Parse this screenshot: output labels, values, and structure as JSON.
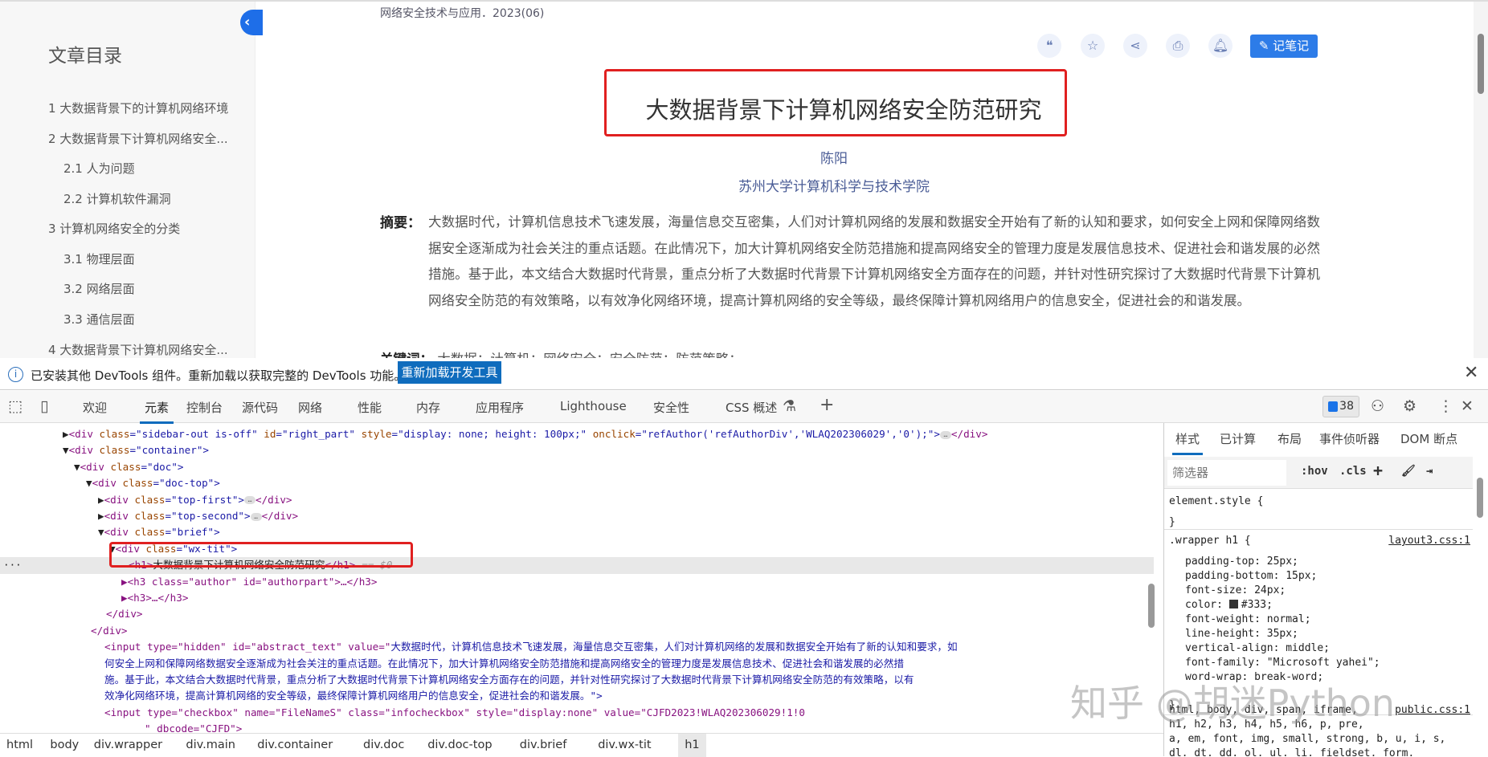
{
  "toc": {
    "title": "文章目录",
    "items": [
      {
        "label": "1 大数据背景下的计算机网络环境",
        "sub": false
      },
      {
        "label": "2 大数据背景下计算机网络安全...",
        "sub": false
      },
      {
        "label": "2.1 人为问题",
        "sub": true
      },
      {
        "label": "2.2 计算机软件漏洞",
        "sub": true
      },
      {
        "label": "3 计算机网络安全的分类",
        "sub": false
      },
      {
        "label": "3.1 物理层面",
        "sub": true
      },
      {
        "label": "3.2 网络层面",
        "sub": true
      },
      {
        "label": "3.3 通信层面",
        "sub": true
      },
      {
        "label": "4 大数据背景下计算机网络安全...",
        "sub": false
      }
    ]
  },
  "article": {
    "journal": "网络安全技术与应用．2023(06)",
    "toolbar": {
      "quote_icon": "quote-icon",
      "fav_icon": "star-icon",
      "share_icon": "share-icon",
      "print_icon": "printer-icon",
      "alert_icon": "bell-icon",
      "note_label": "记笔记"
    },
    "title": "大数据背景下计算机网络安全防范研究",
    "author": "陈阳",
    "affiliation": "苏州大学计算机科学与技术学院",
    "abstract_label": "摘要：",
    "abstract": "大数据时代，计算机信息技术飞速发展，海量信息交互密集，人们对计算机网络的发展和数据安全开始有了新的认知和要求，如何安全上网和保障网络数据安全逐渐成为社会关注的重点话题。在此情况下，加大计算机网络安全防范措施和提高网络安全的管理力度是发展信息技术、促进社会和谐发展的必然措施。基于此，本文结合大数据时代背景，重点分析了大数据时代背景下计算机网络安全方面存在的问题，并针对性研究探讨了大数据时代背景下计算机网络安全防范的有效策略，以有效净化网络环境，提高计算机网络的安全等级，最终保障计算机网络用户的信息安全，促进社会的和谐发展。",
    "keywords_label": "关键词：",
    "keywords": "大数据；计算机；网络安全；安全防范；防范策略；"
  },
  "devtools": {
    "info_message": "已安装其他 DevTools 组件。重新加载以获取完整的 DevTools 功能。",
    "reload_button": "重新加载开发工具",
    "tabs": [
      "欢迎",
      "元素",
      "控制台",
      "源代码",
      "网络",
      "性能",
      "内存",
      "应用程序",
      "Lighthouse",
      "安全性",
      "CSS 概述"
    ],
    "active_tab": "元素",
    "issues_count": "38",
    "dom_lines": [
      [
        "▶",
        "<div ",
        "class",
        "=\"sidebar-out is-off\" ",
        "id",
        "=\"right_part\" ",
        "style",
        "=\"display: none; height: 100px;\" ",
        "onclick",
        "=\"refAuthor('refAuthorDiv','WLAQ202306029','0');\">",
        "…",
        "</div>"
      ],
      [
        "▼",
        "<div ",
        "class",
        "=\"container\">"
      ],
      [
        "▼",
        "<div ",
        "class",
        "=\"doc\">"
      ],
      [
        "▼",
        "<div ",
        "class",
        "=\"doc-top\">"
      ],
      [
        "▶",
        "<div ",
        "class",
        "=\"top-first\">",
        "…",
        "</div>"
      ],
      [
        "▶",
        "<div ",
        "class",
        "=\"top-second\">",
        "…",
        "</div>"
      ],
      [
        "▼",
        "<div ",
        "class",
        "=\"brief\">"
      ],
      [
        "▼",
        "<div ",
        "class",
        "=\"wx-tit\">"
      ]
    ],
    "selected_line": {
      "open": "<h1>",
      "text": "大数据背景下计算机网络安全防范研究",
      "close": "</h1>",
      "marker": "== $0"
    },
    "after_lines": [
      {
        "indent": 8,
        "html": "▶<h3 class=\"author\" id=\"authorpart\">…</h3>"
      },
      {
        "indent": 8,
        "html": "▶<h3>…</h3>"
      },
      {
        "indent": 7,
        "html": "</div>"
      },
      {
        "indent": 6,
        "html": "</div>"
      }
    ],
    "input_hidden_prefix": "<input type=\"hidden\" id=\"abstract_text\" value=\"",
    "input_hidden_lines": [
      "大数据时代，计算机信息技术飞速发展，海量信息交互密集，人们对计算机网络的发展和数据安全开始有了新的认知和要求，如",
      "何安全上网和保障网络数据安全逐渐成为社会关注的重点话题。在此情况下，加大计算机网络安全防范措施和提高网络安全的管理力度是发展信息技术、促进社会和谐发展的必然措",
      "施。基于此，本文结合大数据时代背景，重点分析了大数据时代背景下计算机网络安全方面存在的问题，并针对性研究探讨了大数据时代背景下计算机网络安全防范的有效策略，以有",
      "效净化网络环境，提高计算机网络的安全等级，最终保障计算机网络用户的信息安全，促进社会的和谐发展。\">"
    ],
    "checkbox_line": "<input type=\"checkbox\" name=\"FileNameS\" class=\"infocheckbox\" style=\"display:none\" value=\"CJFD2023!WLAQ202306029!1!0",
    "checkbox_line2": "\" dbcode=\"CJFD\">",
    "breadcrumbs": [
      "html",
      "body",
      "div.wrapper",
      "div.main",
      "div.container",
      "div.doc",
      "div.doc-top",
      "div.brief",
      "div.wx-tit",
      "h1"
    ],
    "styles": {
      "tabs": [
        "样式",
        "已计算",
        "布局",
        "事件侦听器",
        "DOM 断点"
      ],
      "filter_placeholder": "筛选器",
      "hov": ":hov",
      "cls": ".cls",
      "element_style": "element.style {",
      "close_brace": "}",
      "rule_selector": ".wrapper h1 {",
      "rule_source": "layout3.css:1",
      "props": [
        "padding-top: 25px;",
        "padding-bottom: 15px;",
        "font-size: 24px;",
        "color: #333;",
        "font-weight: normal;",
        "line-height: 35px;",
        "vertical-align: middle;",
        "font-family: \"Microsoft yahei\";",
        "word-wrap: break-word;"
      ],
      "color_swatch": "#333333",
      "rule2_selector_lines": [
        "html, body, div, span, iframe,",
        "h1, h2, h3, h4, h5, h6, p, pre,",
        "a, em, font, img, small, strong, b, u, i, s,",
        "dl, dt, dd, ol, ul, li, fieldset, form,"
      ],
      "rule2_source": "public.css:1"
    }
  },
  "watermark": "知乎 @胡迷Python",
  "colors": {
    "accent": "#0f6cbd",
    "highlight_box": "#e02020",
    "note_button": "#2d7ce8",
    "author": "#4a5c96"
  }
}
